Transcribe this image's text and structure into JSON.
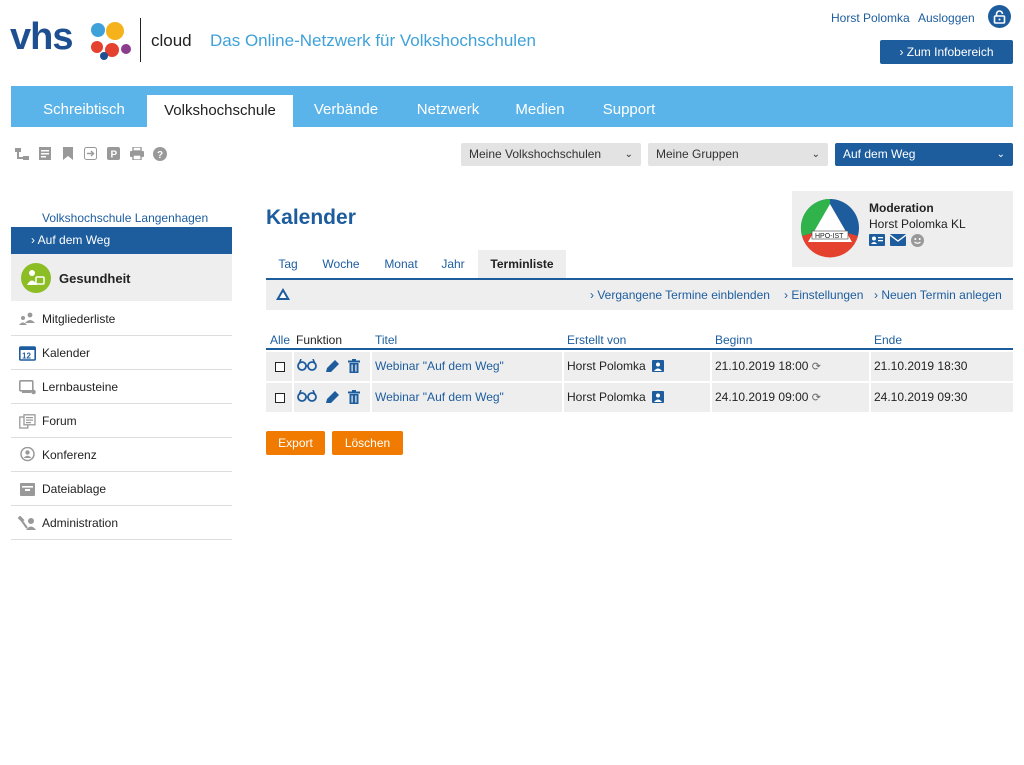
{
  "header": {
    "cloud": "cloud",
    "tagline": "Das Online-Netzwerk für Volkshochschulen",
    "user_name": "Horst Polomka",
    "logout": "Ausloggen",
    "info_button": "› Zum Infobereich",
    "logo_text": "vhs"
  },
  "nav": {
    "tabs": [
      {
        "label": "Schreibtisch"
      },
      {
        "label": "Volkshochschule"
      },
      {
        "label": "Verbände"
      },
      {
        "label": "Netzwerk"
      },
      {
        "label": "Medien"
      },
      {
        "label": "Support"
      }
    ],
    "active": "Volkshochschule"
  },
  "selects": {
    "schools": "Meine Volkshochschulen",
    "groups": "Meine Gruppen",
    "current": "Auf dem Weg"
  },
  "sidebar": {
    "school": "Volkshochschule Langenhagen",
    "group_item": "› Auf dem Weg",
    "group_name": "Gesundheit",
    "items": [
      {
        "label": "Mitgliederliste",
        "icon": "members-icon"
      },
      {
        "label": "Kalender",
        "icon": "calendar-icon"
      },
      {
        "label": "Lernbausteine",
        "icon": "learning-icon"
      },
      {
        "label": "Forum",
        "icon": "forum-icon"
      },
      {
        "label": "Konferenz",
        "icon": "conference-icon"
      },
      {
        "label": "Dateiablage",
        "icon": "folder-icon"
      },
      {
        "label": "Administration",
        "icon": "admin-icon"
      }
    ]
  },
  "main": {
    "title": "Kalender",
    "tabs": [
      {
        "label": "Tag"
      },
      {
        "label": "Woche"
      },
      {
        "label": "Monat"
      },
      {
        "label": "Jahr"
      },
      {
        "label": "Terminliste"
      }
    ],
    "active_tab": "Terminliste",
    "actions": {
      "past": "› Vergangene Termine einblenden",
      "settings": "› Einstellungen",
      "new": "› Neuen Termin anlegen"
    }
  },
  "moderation": {
    "title": "Moderation",
    "name": "Horst Polomka KL",
    "logo_text": "HPO-IST"
  },
  "table": {
    "headers": {
      "all": "Alle",
      "function": "Funktion",
      "title": "Titel",
      "created_by": "Erstellt von",
      "start": "Beginn",
      "end": "Ende"
    },
    "rows": [
      {
        "title": "Webinar \"Auf dem Weg\"",
        "created_by": "Horst Polomka",
        "start": "21.10.2019 18:00",
        "end": "21.10.2019 18:30"
      },
      {
        "title": "Webinar \"Auf dem Weg\"",
        "created_by": "Horst Polomka",
        "start": "24.10.2019 09:00",
        "end": "24.10.2019 09:30"
      }
    ]
  },
  "buttons": {
    "export": "Export",
    "delete": "Löschen"
  },
  "colors": {
    "brand_blue": "#1d5d9e",
    "nav_blue": "#5ab4ea",
    "orange": "#f07b00"
  }
}
